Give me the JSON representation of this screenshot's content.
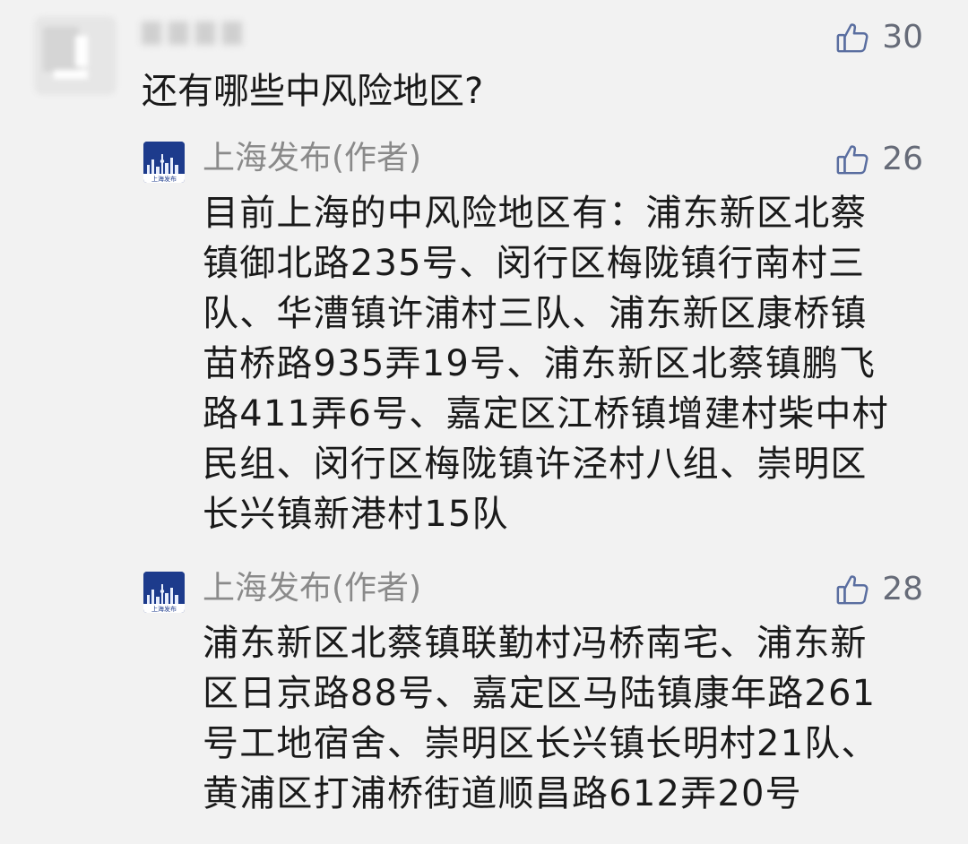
{
  "top_comment": {
    "question": "还有哪些中风险地区?",
    "likes": "30"
  },
  "replies": [
    {
      "author": "上海发布(作者)",
      "avatar_text": "上海发布",
      "likes": "26",
      "body_lines": [
        "目前上海的中风险地区有：浦东新区北蔡",
        "镇御北路235号、闵行区梅陇镇行南村三",
        "队、华漕镇许浦村三队、浦东新区康桥镇",
        "苗桥路935弄19号、浦东新区北蔡镇鹏飞",
        "路411弄6号、嘉定区江桥镇增建村柴中村",
        "民组、闵行区梅陇镇许泾村八组、崇明区",
        "长兴镇新港村15队"
      ]
    },
    {
      "author": "上海发布(作者)",
      "avatar_text": "上海发布",
      "likes": "28",
      "body_lines": [
        "浦东新区北蔡镇联勤村冯桥南宅、浦东新",
        "区日京路88号、嘉定区马陆镇康年路261",
        "号工地宿舍、崇明区长兴镇长明村21队、",
        "黄浦区打浦桥街道顺昌路612弄20号"
      ]
    }
  ],
  "icons": {
    "like": "thumbs-up-icon"
  },
  "colors": {
    "background": "#f2f2f2",
    "text": "#1a1a1a",
    "author": "#8a8a8a",
    "like_icon": "#5a6ea0",
    "avatar_bg": "#1d3b8c"
  }
}
